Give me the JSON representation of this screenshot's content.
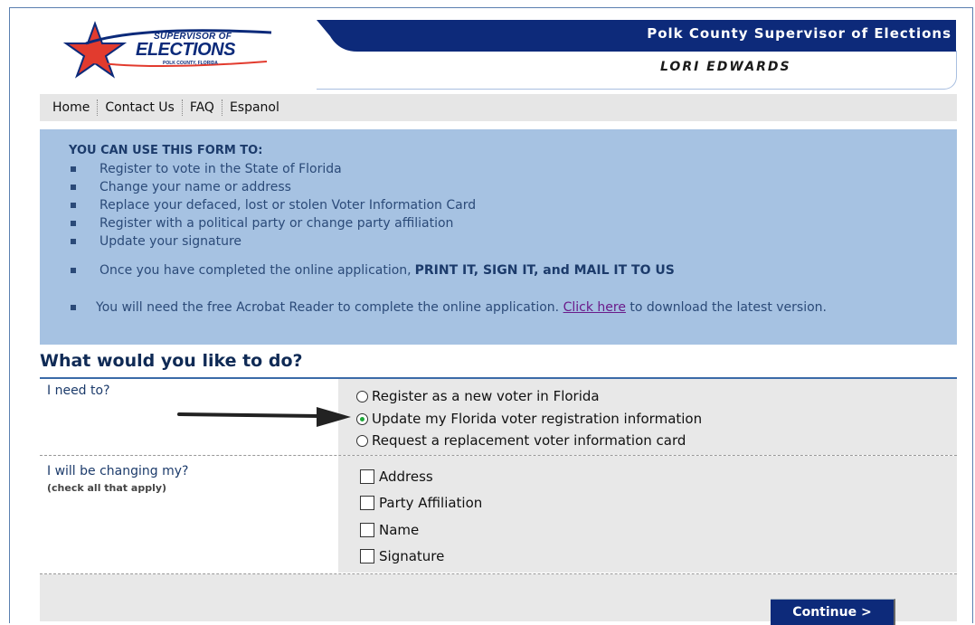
{
  "header": {
    "logo_line1": "SUPERVISOR OF",
    "logo_line2": "ELECTIONS",
    "logo_line3": "POLK COUNTY, FLORIDA",
    "title": "Polk County Supervisor of Elections",
    "subtitle": "LORI EDWARDS"
  },
  "nav": {
    "items": [
      "Home",
      "Contact Us",
      "FAQ",
      "Espanol"
    ]
  },
  "info": {
    "heading": "YOU CAN USE THIS FORM TO:",
    "bullets": [
      "Register to vote in the State of Florida",
      "Change your name or address",
      "Replace your defaced, lost or stolen Voter Information Card",
      "Register with a political party or change party affiliation",
      "Update your signature"
    ],
    "note1_text": "Once you have completed the online application,",
    "note1_bold": "PRINT IT, SIGN IT, and MAIL IT TO US",
    "note2_pre": "You will need the free Acrobat Reader to complete the online application.",
    "note2_link": "Click here",
    "note2_post": "to download the latest version."
  },
  "form": {
    "question": "What would you like to do?",
    "need_label": "I need to?",
    "need_options": [
      {
        "label": "Register as a new voter in Florida",
        "selected": false
      },
      {
        "label": "Update my Florida voter registration information",
        "selected": true
      },
      {
        "label": "Request a replacement voter information card",
        "selected": false
      }
    ],
    "change_label": "I will be changing my?",
    "change_hint": "(check all that apply)",
    "change_options": [
      {
        "label": "Address",
        "checked": false
      },
      {
        "label": "Party Affiliation",
        "checked": false
      },
      {
        "label": "Name",
        "checked": false
      },
      {
        "label": "Signature",
        "checked": false
      }
    ],
    "continue_label": "Continue  >"
  },
  "colors": {
    "accent": "#0d2a7a",
    "info_bg": "#a6c2e2",
    "radio_selected": "#1fa83a"
  }
}
